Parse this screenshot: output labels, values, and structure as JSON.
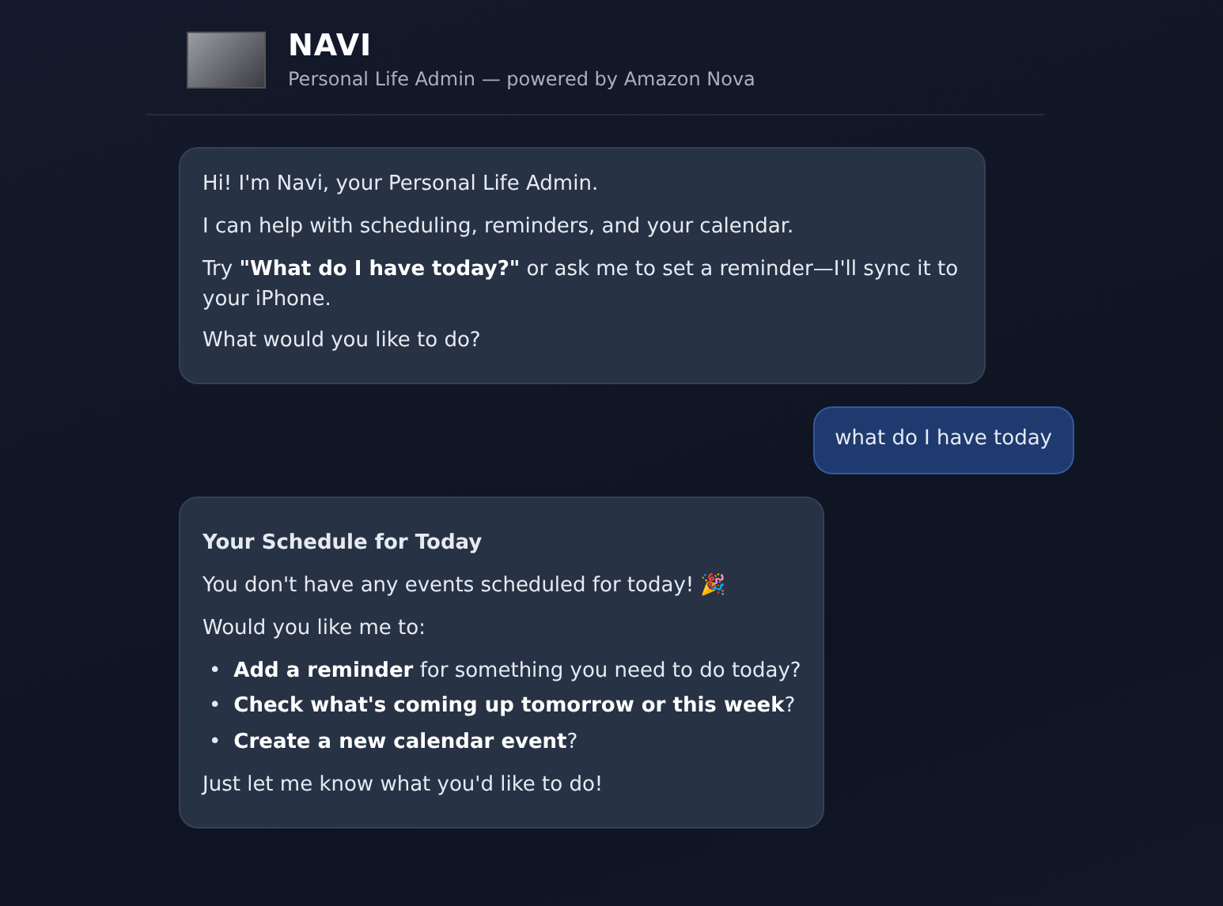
{
  "header": {
    "title": "NAVI",
    "subtitle": "Personal Life Admin — powered by Amazon Nova"
  },
  "messages": [
    {
      "kind": "assistant",
      "blocks": [
        {
          "kind": "p",
          "text": "Hi! I'm Navi, your Personal Life Admin."
        },
        {
          "kind": "p",
          "text": "I can help with scheduling, reminders, and your calendar."
        },
        {
          "kind": "p",
          "text": "Try **\"What do I have today?\"** or ask me to set a reminder—I'll sync it to your iPhone."
        },
        {
          "kind": "p",
          "text": "What would you like to do?"
        }
      ]
    },
    {
      "kind": "user",
      "blocks": [
        {
          "kind": "p",
          "text": "what do I have today"
        }
      ]
    },
    {
      "kind": "assistant",
      "blocks": [
        {
          "kind": "heading",
          "text": "Your Schedule for Today"
        },
        {
          "kind": "p",
          "text": "You don't have any events scheduled for today! 🎉"
        },
        {
          "kind": "p",
          "text": "Would you like me to:"
        },
        {
          "kind": "list",
          "items": [
            {
              "marker": "•",
              "text": "**Add a reminder** for something you need to do today?"
            },
            {
              "marker": "•",
              "text": "**Check what's coming up tomorrow or this week**?"
            },
            {
              "marker": "•",
              "text": "**Create a new calendar event**?"
            }
          ]
        },
        {
          "kind": "p",
          "text": "Just let me know what you'd like to do!"
        }
      ]
    }
  ]
}
